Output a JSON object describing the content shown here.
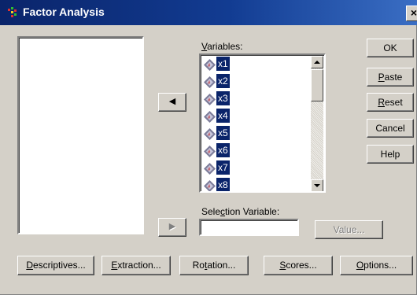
{
  "window": {
    "title": "Factor Analysis",
    "close_glyph": "×"
  },
  "variables": {
    "label": "Variables:",
    "mnemonic": "V",
    "label_rest": "ariables:",
    "items": [
      "x1",
      "x2",
      "x3",
      "x4",
      "x5",
      "x6",
      "x7",
      "x8"
    ]
  },
  "selection": {
    "label_pre": "Sele",
    "mnemonic": "c",
    "label_post": "tion Variable:",
    "value": ""
  },
  "buttons": {
    "ok": "OK",
    "paste_m": "P",
    "paste_r": "aste",
    "reset_m": "R",
    "reset_r": "eset",
    "cancel": "Cancel",
    "help": "Help",
    "value": "Value...",
    "descriptives_m": "D",
    "descriptives_r": "escriptives...",
    "extraction_m": "E",
    "extraction_r": "xtraction...",
    "rotation_pre": "Ro",
    "rotation_m": "t",
    "rotation_post": "ation...",
    "scores_m": "S",
    "scores_r": "cores...",
    "options_m": "O",
    "options_r": "ptions..."
  },
  "arrows": {
    "move_to_variables": "◀",
    "move_to_selection": "▶"
  },
  "colors": {
    "title_bar": "#0a246a",
    "selection": "#0a246a",
    "face": "#d4d0c8"
  }
}
